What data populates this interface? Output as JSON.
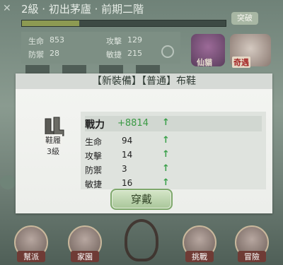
{
  "background": {
    "top_title": "2級 · 初出茅廬 · 前期二階",
    "progress_fraction": 0.28,
    "special_button": "突破",
    "stats": [
      {
        "label": "生命",
        "value": "853"
      },
      {
        "label": "攻擊",
        "value": "129"
      },
      {
        "label": "防禦",
        "value": "28"
      },
      {
        "label": "敏捷",
        "value": "215"
      }
    ],
    "icons": [
      {
        "name": "cat-icon",
        "label": "仙貓"
      },
      {
        "name": "dragon-icon",
        "label": "奇遇"
      }
    ]
  },
  "dialog": {
    "title": "【新裝備】【普通】布鞋",
    "item": {
      "name": "鞋履",
      "level": "3級",
      "icon": "boots-icon"
    },
    "power": {
      "label": "戰力",
      "value": "+8814",
      "arrow": "↑"
    },
    "stats": [
      {
        "label": "生命",
        "value": "94",
        "arrow": "↑"
      },
      {
        "label": "攻擊",
        "value": "14",
        "arrow": "↑"
      },
      {
        "label": "防禦",
        "value": "3",
        "arrow": "↑"
      },
      {
        "label": "敏捷",
        "value": "16",
        "arrow": "↑"
      }
    ],
    "equip_button": "穿戴"
  },
  "nav": {
    "items": [
      {
        "label": "幫派"
      },
      {
        "label": "家園"
      },
      {
        "label": "挑戰"
      },
      {
        "label": "冒險"
      }
    ]
  },
  "colors": {
    "accent_green": "#3aa04a",
    "power_value": "#3b9a45"
  }
}
